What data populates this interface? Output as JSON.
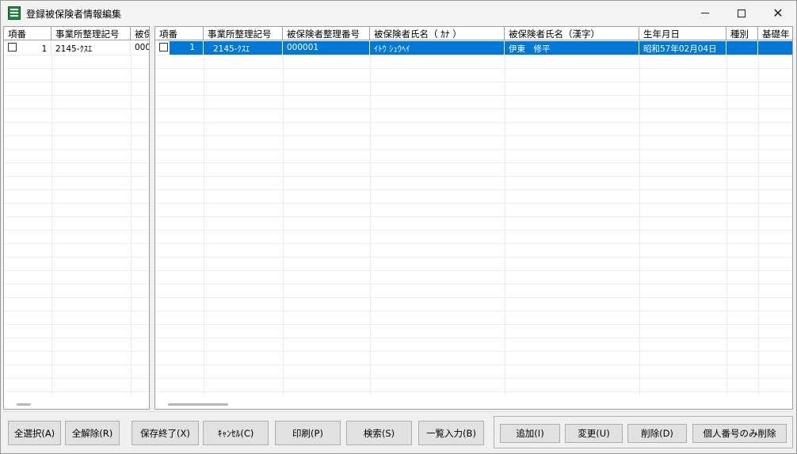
{
  "window": {
    "title": "登録被保険者情報編集"
  },
  "left_grid": {
    "headers": [
      "項番",
      "事業所整理記号",
      "被保"
    ],
    "rows": [
      {
        "no": "1",
        "office_code": "2145-ｸｽｴ",
        "insured": "000"
      }
    ]
  },
  "right_grid": {
    "headers": [
      "項番",
      "事業所整理記号",
      "被保険者整理番号",
      "被保険者氏名（ ｶﾅ ）",
      "被保険者氏名（漢字）",
      "生年月日",
      "種別",
      "基礎年"
    ],
    "rows": [
      {
        "no": "1",
        "office_code": "2145-ｸｽｴ",
        "insured_no": "000001",
        "name_kana": "ｲﾄｳ ｼｭｳﾍｲ",
        "name_kanji": "伊東　修平",
        "birth": "昭和57年02月04日",
        "type": "",
        "pension": ""
      }
    ]
  },
  "buttons": {
    "select_all": "全選択(A)",
    "deselect_all": "全解除(R)",
    "save_exit": "保存終了(X)",
    "cancel": "ｷｬﾝｾﾙ(C)",
    "print": "印刷(P)",
    "search": "検索(S)",
    "batch_input": "一覧入力(B)",
    "add": "追加(I)",
    "modify": "変更(U)",
    "delete": "削除(D)",
    "delete_mynumber": "個人番号のみ削除"
  }
}
